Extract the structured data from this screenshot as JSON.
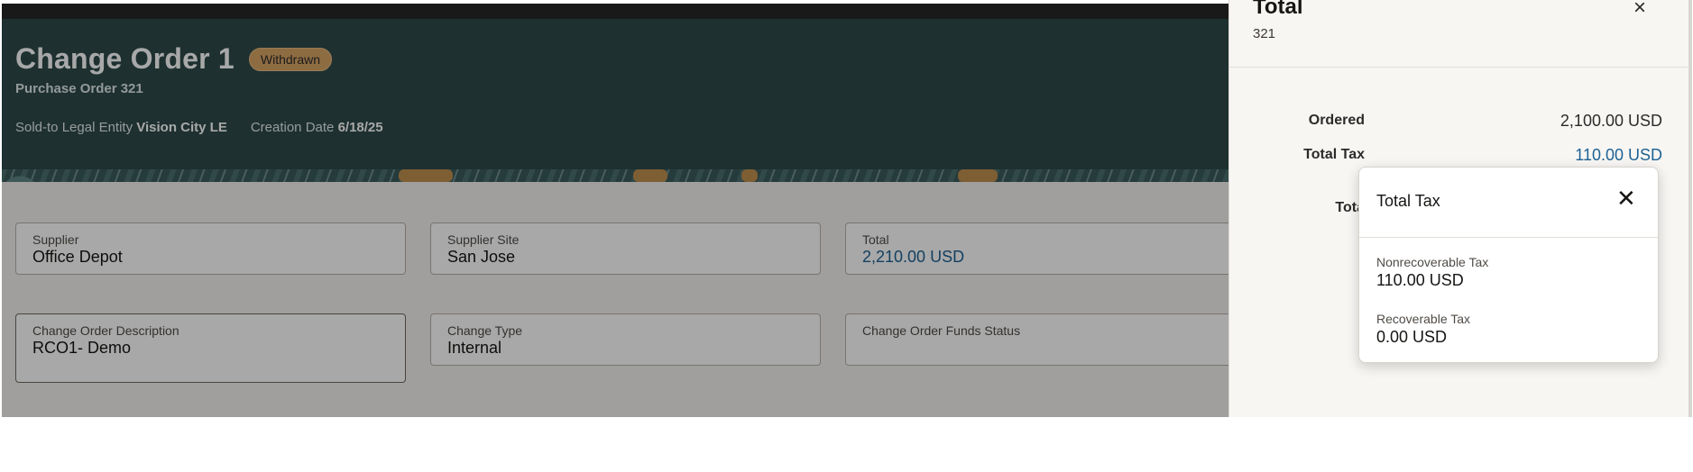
{
  "page": {
    "title": "Change Order 1",
    "status": "Withdrawn",
    "subtitle": "Purchase Order 321",
    "sold_to_label": "Sold-to Legal Entity",
    "sold_to_value": "Vision City LE",
    "creation_date_label": "Creation Date",
    "creation_date_value": "6/18/25"
  },
  "fields": {
    "supplier": {
      "label": "Supplier",
      "value": "Office Depot"
    },
    "supplier_site": {
      "label": "Supplier Site",
      "value": "San Jose"
    },
    "total": {
      "label": "Total",
      "value": "2,210.00 USD"
    },
    "description": {
      "label": "Change Order Description",
      "value": "RCO1- Demo"
    },
    "change_type": {
      "label": "Change Type",
      "value": "Internal"
    },
    "funds_status": {
      "label": "Change Order Funds Status",
      "value": ""
    }
  },
  "drawer": {
    "title": "Total",
    "subtitle": "321",
    "close_icon": "×",
    "rows": [
      {
        "label": "Ordered",
        "value": "2,100.00 USD"
      },
      {
        "label": "Total Tax",
        "value": "110.00 USD"
      },
      {
        "label": "Tota"
      }
    ]
  },
  "popup": {
    "title": "Total Tax",
    "close_icon": "✕",
    "items": [
      {
        "label": "Nonrecoverable Tax",
        "value": "110.00 USD"
      },
      {
        "label": "Recoverable Tax",
        "value": "0.00 USD"
      }
    ]
  },
  "colors": {
    "header": "#2e4a4a",
    "badge": "#d8a465",
    "link": "#1d6294"
  }
}
